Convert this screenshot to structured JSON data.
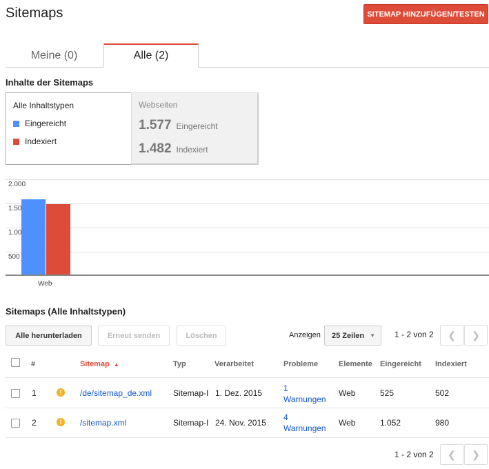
{
  "header": {
    "title": "Sitemaps",
    "add_button": "SITEMAP HINZUFÜGEN/TESTEN"
  },
  "tabs": [
    {
      "label": "Meine (0)"
    },
    {
      "label": "Alle (2)"
    }
  ],
  "contents": {
    "heading": "Inhalte der Sitemaps",
    "legend_title": "Alle Inhaltstypen",
    "legend": [
      {
        "label": "Eingereicht",
        "color": "#4d90fe"
      },
      {
        "label": "Indexiert",
        "color": "#dd4b39"
      }
    ],
    "stats_title": "Webseiten",
    "stats": [
      {
        "value": "1.577",
        "label": "Eingereicht"
      },
      {
        "value": "1.482",
        "label": "Indexiert"
      }
    ]
  },
  "chart_data": {
    "type": "bar",
    "categories": [
      "Web"
    ],
    "series": [
      {
        "name": "Eingereicht",
        "values": [
          1577
        ],
        "color": "#4d90fe"
      },
      {
        "name": "Indexiert",
        "values": [
          1482
        ],
        "color": "#dd4b39"
      }
    ],
    "ytick_labels": [
      "2.000",
      "1.500",
      "1.000",
      "500"
    ],
    "ylim": [
      0,
      2000
    ]
  },
  "table_section": {
    "heading": "Sitemaps (Alle Inhaltstypen)",
    "download_button": "Alle herunterladen",
    "resend_button": "Erneut senden",
    "delete_button": "Löschen",
    "show_label": "Anzeigen",
    "rows_select": "25 Zeilen",
    "range_text": "1 - 2 von 2",
    "columns": [
      "#",
      "Sitemap",
      "Typ",
      "Verarbeitet",
      "Probleme",
      "Elemente",
      "Eingereicht",
      "Indexiert"
    ],
    "rows": [
      {
        "num": "1",
        "sitemap": "/de/sitemap_de.xml",
        "type": "Sitemap-I",
        "processed": "1. Dez. 2015",
        "issues_count": "1",
        "issues_text": "Warnungen",
        "elements": "Web",
        "submitted": "525",
        "indexed": "502"
      },
      {
        "num": "2",
        "sitemap": "/sitemap.xml",
        "type": "Sitemap-I",
        "processed": "24. Nov. 2015",
        "issues_count": "4",
        "issues_text": "Warnungen",
        "elements": "Web",
        "submitted": "1.052",
        "indexed": "980"
      }
    ],
    "footer_range": "1 - 2 von 2"
  }
}
